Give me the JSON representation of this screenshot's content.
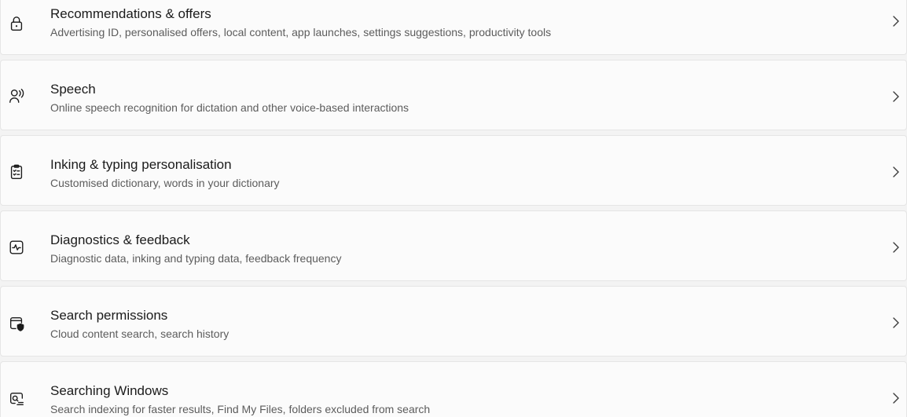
{
  "items": [
    {
      "icon": "lock-icon",
      "title": "Recommendations & offers",
      "subtitle": "Advertising ID, personalised offers, local content, app launches, settings suggestions, productivity tools"
    },
    {
      "icon": "speech-icon",
      "title": "Speech",
      "subtitle": "Online speech recognition for dictation and other voice-based interactions"
    },
    {
      "icon": "clipboard-checklist-icon",
      "title": "Inking & typing personalisation",
      "subtitle": "Customised dictionary, words in your dictionary"
    },
    {
      "icon": "diagnostics-pulse-icon",
      "title": "Diagnostics & feedback",
      "subtitle": "Diagnostic data, inking and typing data, feedback frequency"
    },
    {
      "icon": "search-shield-icon",
      "title": "Search permissions",
      "subtitle": "Cloud content search, search history"
    },
    {
      "icon": "searching-windows-icon",
      "title": "Searching Windows",
      "subtitle": "Search indexing for faster results, Find My Files, folders excluded from search"
    }
  ]
}
